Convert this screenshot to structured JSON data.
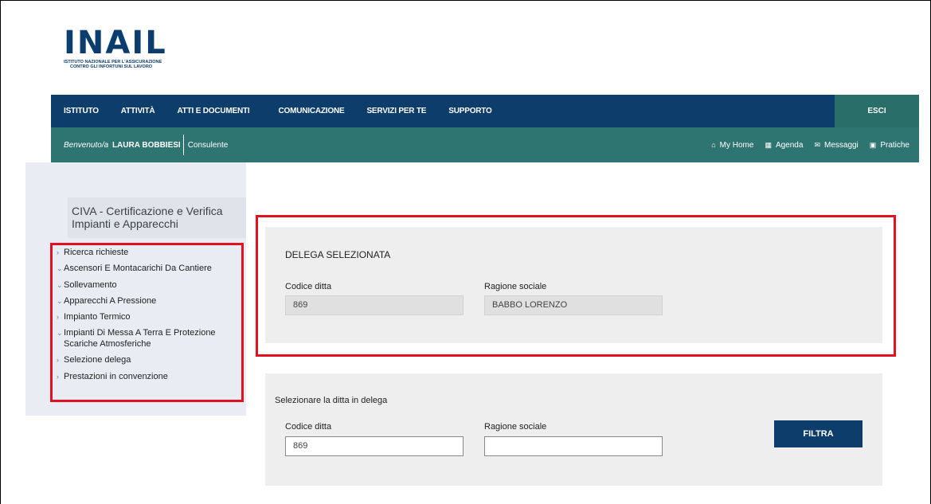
{
  "logo": {
    "mark": "INAIL",
    "subtitle_line1": "ISTITUTO NAZIONALE PER L'ASSICURAZIONE",
    "subtitle_line2": "CONTRO GLI INFORTUNI SUL LAVORO"
  },
  "topnav": {
    "items": [
      {
        "label": "ISTITUTO"
      },
      {
        "label": "ATTIVITÀ"
      },
      {
        "label": "ATTI E DOCUMENTI"
      },
      {
        "label": "COMUNICAZIONE"
      },
      {
        "label": "SERVIZI PER TE"
      },
      {
        "label": "SUPPORTO"
      }
    ],
    "logout_label": "ESCI"
  },
  "userbar": {
    "welcome_prefix": "Benvenuto/a",
    "user_name": "LAURA BOBBIESI",
    "role": "Consulente",
    "links": [
      {
        "label": "My Home",
        "icon": "home-icon",
        "glyph": "⌂"
      },
      {
        "label": "Agenda",
        "icon": "calendar-icon",
        "glyph": "▦"
      },
      {
        "label": "Messaggi",
        "icon": "envelope-icon",
        "glyph": "✉"
      },
      {
        "label": "Pratiche",
        "icon": "folder-icon",
        "glyph": "▣"
      }
    ]
  },
  "sidebar": {
    "title": "CIVA - Certificazione e Verifica Impianti e Apparecchi",
    "items": [
      {
        "label": "Ricerca richieste",
        "chevron": "›"
      },
      {
        "label": "Ascensori E Montacarichi Da Cantiere",
        "chevron": "⌄"
      },
      {
        "label": "Sollevamento",
        "chevron": "⌄"
      },
      {
        "label": "Apparecchi A Pressione",
        "chevron": "⌄"
      },
      {
        "label": "Impianto Termico",
        "chevron": "›"
      },
      {
        "label": "Impianti Di Messa A Terra E Protezione Scariche Atmosferiche",
        "chevron": "⌄"
      },
      {
        "label": "Selezione delega",
        "chevron": "›"
      },
      {
        "label": "Prestazioni in convenzione",
        "chevron": "›"
      }
    ]
  },
  "delega": {
    "title": "DELEGA SELEZIONATA",
    "codice_label": "Codice ditta",
    "codice_value": "869",
    "ragione_label": "Ragione sociale",
    "ragione_value": "BABBO LORENZO"
  },
  "filter": {
    "title": "Selezionare la ditta in delega",
    "codice_label": "Codice ditta",
    "codice_value": "869",
    "ragione_label": "Ragione sociale",
    "ragione_value": "",
    "button_label": "FILTRA"
  },
  "colors": {
    "nav_blue": "#0d3d6b",
    "teal": "#2e7470",
    "highlight_red": "#e3101f"
  }
}
